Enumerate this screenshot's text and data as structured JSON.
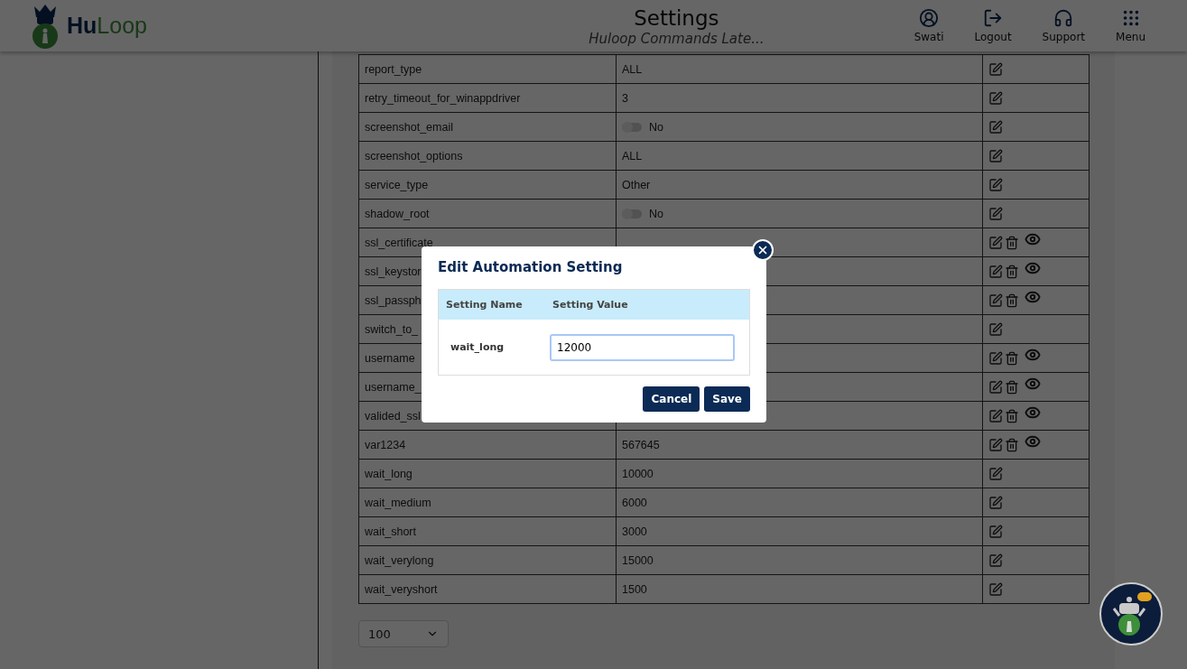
{
  "header": {
    "logo_text": [
      "Hu",
      "Loop"
    ],
    "title": "Settings",
    "subtitle": "Huloop Commands Late...",
    "nav": [
      {
        "kind": "user",
        "label": "Swati"
      },
      {
        "kind": "logout",
        "label": "Logout"
      },
      {
        "kind": "support",
        "label": "Support"
      },
      {
        "kind": "menu",
        "label": "Menu"
      }
    ]
  },
  "rows": [
    {
      "name": "report_type",
      "value": {
        "kind": "text",
        "text": "ALL"
      },
      "kind": "basic"
    },
    {
      "name": "retry_timeout_for_winappdriver",
      "value": {
        "kind": "text",
        "text": "3"
      },
      "kind": "basic"
    },
    {
      "name": "screenshot_email",
      "value": {
        "kind": "toggle",
        "on": false,
        "text": "No"
      },
      "kind": "basic"
    },
    {
      "name": "screenshot_options",
      "value": {
        "kind": "text",
        "text": "ALL"
      },
      "kind": "basic"
    },
    {
      "name": "service_type",
      "value": {
        "kind": "text",
        "text": "Other"
      },
      "kind": "basic"
    },
    {
      "name": "shadow_root",
      "value": {
        "kind": "toggle",
        "on": false,
        "text": "No"
      },
      "kind": "basic"
    },
    {
      "name": "ssl_certificate",
      "kind": "custom"
    },
    {
      "name": "ssl_keystor",
      "kind": "custom"
    },
    {
      "name": "ssl_passph",
      "kind": "custom"
    },
    {
      "name": "switch_to_",
      "kind": "basic"
    },
    {
      "name": "username",
      "kind": "custom"
    },
    {
      "name": "username_",
      "kind": "custom"
    },
    {
      "name": "valided_ssl",
      "kind": "custom"
    },
    {
      "name": "var1234",
      "value": {
        "kind": "text",
        "text": "567645"
      },
      "kind": "custom"
    },
    {
      "name": "wait_long",
      "value": {
        "kind": "text",
        "text": "10000"
      },
      "kind": "basic"
    },
    {
      "name": "wait_medium",
      "value": {
        "kind": "text",
        "text": "6000"
      },
      "kind": "basic"
    },
    {
      "name": "wait_short",
      "value": {
        "kind": "text",
        "text": "3000"
      },
      "kind": "basic"
    },
    {
      "name": "wait_verylong",
      "value": {
        "kind": "text",
        "text": "15000"
      },
      "kind": "basic"
    },
    {
      "name": "wait_veryshort",
      "value": {
        "kind": "text",
        "text": "1500"
      },
      "kind": "basic"
    }
  ],
  "page_size": "100",
  "dialog": {
    "title": "Edit Automation Setting",
    "columns": [
      "Setting Name",
      "Setting Value"
    ],
    "setting_name": "wait_long",
    "setting_value": "12000",
    "buttons": [
      "Cancel",
      "Save"
    ]
  }
}
